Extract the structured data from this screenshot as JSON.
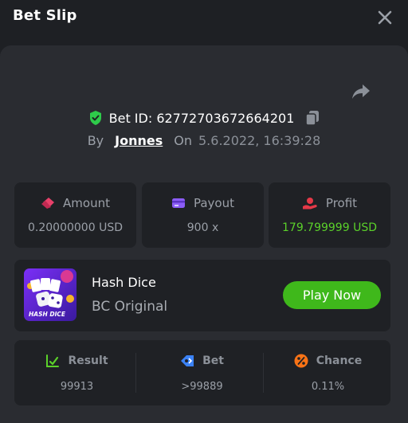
{
  "header": {
    "title": "Bet Slip"
  },
  "bet": {
    "id_text": "Bet ID: 62772703672664201",
    "by_label": "By",
    "user": "Jonnes",
    "on_label": "On",
    "datetime": "5.6.2022, 16:39:28"
  },
  "stats": {
    "amount": {
      "label": "Amount",
      "value": "0.20000000 USD"
    },
    "payout": {
      "label": "Payout",
      "value": "900 x"
    },
    "profit": {
      "label": "Profit",
      "value": "179.799999 USD"
    }
  },
  "game": {
    "name": "Hash Dice",
    "provider": "BC Original",
    "thumb_text": "HASH DICE",
    "play_label": "Play Now"
  },
  "result": {
    "result": {
      "label": "Result",
      "value": "99913"
    },
    "bet": {
      "label": "Bet",
      "value": ">99889"
    },
    "chance": {
      "label": "Chance",
      "value": "0.11%"
    }
  },
  "colors": {
    "accent_green": "#3fb81b",
    "profit_green": "#5bd12a",
    "shield_green": "#2ecb4a",
    "payout_purple": "#8b5cf6",
    "amount_pink": "#e8406a",
    "profit_red": "#e53948",
    "bet_blue": "#3b82f6",
    "chance_orange": "#f97316"
  },
  "icons": {
    "close": "close-icon",
    "share": "share-icon",
    "shield": "shield-check-icon",
    "copy": "copy-icon",
    "amount": "ticket-icon",
    "payout": "card-icon",
    "profit": "hand-coin-icon",
    "result": "chart-check-icon",
    "bet": "tag-icon",
    "chance": "percent-icon"
  }
}
